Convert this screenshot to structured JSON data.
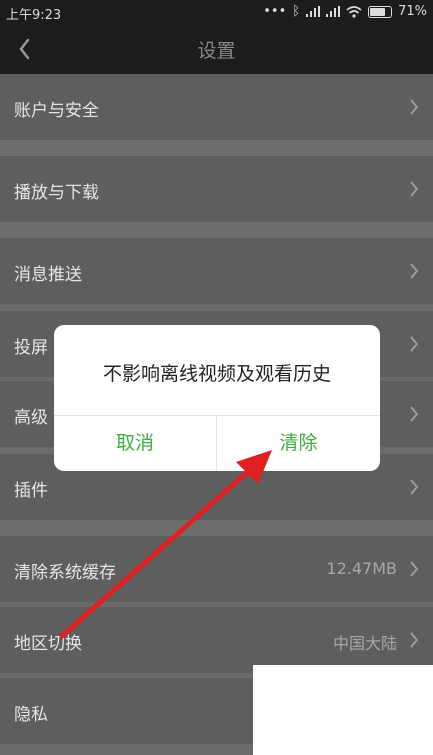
{
  "status_bar": {
    "time": "上午9:23",
    "battery": "71%"
  },
  "nav": {
    "title": "设置"
  },
  "rows": [
    {
      "label": "账户与安全",
      "value": ""
    },
    {
      "label": "播放与下载",
      "value": ""
    },
    {
      "label": "消息推送",
      "value": ""
    },
    {
      "label": "投屏",
      "value": ""
    },
    {
      "label": "高级",
      "value": ""
    },
    {
      "label": "插件",
      "value": ""
    },
    {
      "label": "清除系统缓存",
      "value": "12.47MB"
    },
    {
      "label": "地区切换",
      "value": "中国大陆"
    },
    {
      "label": "隐私",
      "value": ""
    }
  ],
  "dialog": {
    "message": "不影响离线视频及观看历史",
    "cancel_label": "取消",
    "confirm_label": "清除"
  },
  "colors": {
    "accent_green": "#3fae3f",
    "annotation_arrow": "#e02020"
  }
}
